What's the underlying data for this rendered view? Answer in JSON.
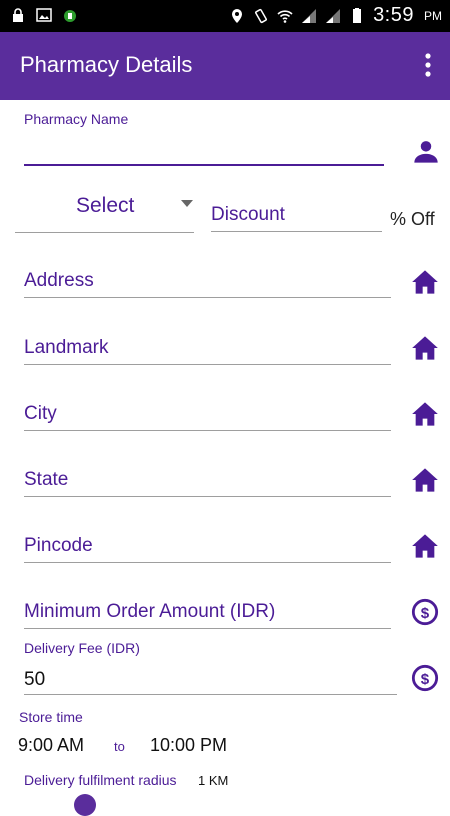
{
  "status_bar": {
    "time": "3:59",
    "ampm": "PM"
  },
  "app_bar": {
    "title": "Pharmacy Details"
  },
  "form": {
    "pharmacy_name_label": "Pharmacy Name",
    "pharmacy_name_value": "",
    "select_label": "Select",
    "discount_placeholder": "Discount",
    "discount_suffix": "% Off",
    "address_placeholder": "Address",
    "landmark_placeholder": "Landmark",
    "city_placeholder": "City",
    "state_placeholder": "State",
    "pincode_placeholder": "Pincode",
    "min_order_placeholder": "Minimum Order Amount (IDR)",
    "delivery_fee_label": "Delivery Fee (IDR)",
    "delivery_fee_value": "50",
    "store_time_label": "Store time",
    "store_time_start": "9:00 AM",
    "store_time_to": "to",
    "store_time_end": "10:00 PM",
    "delivery_radius_label": "Delivery fulfilment radius",
    "delivery_radius_value": "1 KM"
  },
  "icons": {
    "person": "person-icon",
    "home": "home-icon",
    "currency": "currency-icon"
  },
  "colors": {
    "accent": "#5a2d9c",
    "text_accent": "#4b1c96"
  }
}
